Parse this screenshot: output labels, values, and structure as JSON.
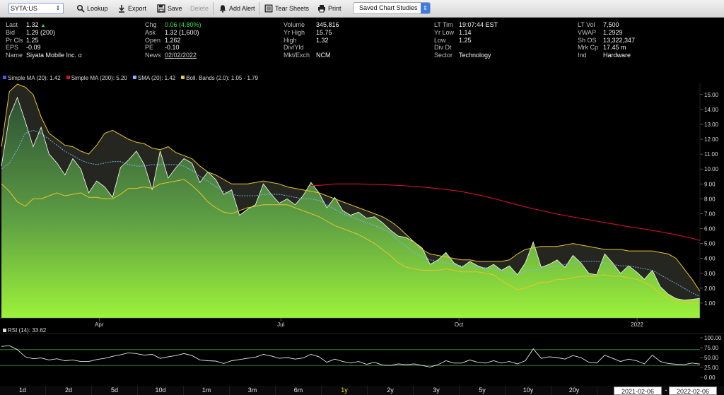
{
  "toolbar": {
    "ticker_value": "SYTA:US",
    "buttons": [
      {
        "label": "Lookup",
        "icon": "magnifier-icon"
      },
      {
        "label": "Export",
        "icon": "download-icon"
      },
      {
        "label": "Save",
        "icon": "floppy-icon"
      },
      {
        "label": "Delete",
        "icon": "none"
      },
      {
        "label": "Add Alert",
        "icon": "bell-icon"
      },
      {
        "label": "Tear Sheets",
        "icon": "sheet-icon"
      },
      {
        "label": "Print",
        "icon": "printer-icon"
      }
    ],
    "studies_label": "Saved Chart Studies"
  },
  "quote": {
    "col1": [
      {
        "label": "Last",
        "value": "1.32"
      },
      {
        "label": "Bid",
        "value": "1.29 (200)"
      },
      {
        "label": "Pr Cls",
        "value": "1.25"
      },
      {
        "label": "EPS",
        "value": "-0.09"
      },
      {
        "label": "Name",
        "value": "Siyata Mobile Inc."
      }
    ],
    "col2": [
      {
        "label": "Chg",
        "value": "0.06 (4.80%)"
      },
      {
        "label": "Ask",
        "value": "1.32 (1,600)"
      },
      {
        "label": "Open",
        "value": "1.262"
      },
      {
        "label": "PE",
        "value": "-0.10"
      },
      {
        "label": "News",
        "value": "02/02/2022"
      }
    ],
    "col3": [
      {
        "label": "Volume",
        "value": "345,816"
      },
      {
        "label": "Yr High",
        "value": "15.75"
      },
      {
        "label": "High",
        "value": "1.32"
      },
      {
        "label": "Div/Yld",
        "value": ""
      },
      {
        "label": "Mkt/Exch",
        "value": "NCM"
      }
    ],
    "col4": [
      {
        "label": "LT Tim",
        "value": "19:07:44 EST"
      },
      {
        "label": "Yr Low",
        "value": "1.14"
      },
      {
        "label": "Low",
        "value": "1.25"
      },
      {
        "label": "Div Dt",
        "value": ""
      },
      {
        "label": "Sector",
        "value": "Technology"
      }
    ],
    "col5": [
      {
        "label": "LT Vol",
        "value": "7,500"
      },
      {
        "label": "VWAP",
        "value": "1.2929"
      },
      {
        "label": "Sh OS",
        "value": "13,322,347"
      },
      {
        "label": "Mrk Cp",
        "value": "17.45 m"
      },
      {
        "label": "Ind",
        "value": "Hardware"
      }
    ],
    "name_suffix": "α",
    "colors": {
      "up": "#35e24a"
    }
  },
  "legend": [
    {
      "label": "Simple MA (20): 1.42",
      "color": "#3a5cff"
    },
    {
      "label": "Simple MA (200): 5.20",
      "color": "#d0122c"
    },
    {
      "label": "SMA (20): 1.42",
      "color": "#7fb6ff"
    },
    {
      "label": "Boll. Bands (2.0): 1.05 - 1.79",
      "color": "#e6c62c"
    }
  ],
  "chart_data": [
    {
      "type": "area",
      "yticks": [
        "1.00",
        "2.00",
        "3.00",
        "4.00",
        "5.00",
        "6.00",
        "7.00",
        "8.00",
        "9.00",
        "10.00",
        "11.00",
        "12.00",
        "13.00",
        "14.00",
        "15.00"
      ],
      "ylim": [
        0,
        15.75
      ],
      "xticks": [
        "Apr",
        "Jul",
        "Oct",
        "2022"
      ],
      "xtick_pos": [
        0.14,
        0.4,
        0.655,
        0.91
      ],
      "price": [
        10.2,
        13.5,
        14.8,
        13.2,
        11.5,
        12.8,
        11.0,
        10.4,
        9.6,
        10.7,
        10.0,
        8.4,
        9.2,
        8.8,
        8.1,
        10.1,
        10.6,
        11.2,
        10.3,
        8.6,
        11.2,
        9.4,
        10.1,
        10.7,
        10.4,
        9.1,
        9.8,
        9.3,
        8.3,
        8.6,
        6.9,
        7.3,
        7.6,
        9.0,
        8.3,
        7.7,
        8.0,
        7.6,
        8.2,
        9.1,
        8.4,
        7.4,
        8.1,
        7.2,
        6.9,
        7.1,
        6.7,
        6.8,
        6.4,
        5.9,
        5.5,
        5.4,
        5.1,
        4.7,
        3.6,
        3.9,
        4.4,
        3.7,
        3.4,
        3.8,
        3.5,
        3.3,
        3.6,
        3.2,
        3.5,
        2.9,
        3.7,
        5.1,
        3.4,
        3.6,
        3.9,
        3.4,
        4.2,
        3.7,
        3.0,
        2.9,
        4.3,
        3.7,
        3.0,
        3.5,
        3.1,
        2.6,
        3.2,
        2.1,
        1.6,
        1.3,
        1.2,
        1.25,
        1.32
      ],
      "bb_upper": [
        11.5,
        15.2,
        15.7,
        15.5,
        15.0,
        13.5,
        12.4,
        12.0,
        11.6,
        11.5,
        11.2,
        11.0,
        11.6,
        12.4,
        12.6,
        12.3,
        12.0,
        11.8,
        11.7,
        11.4,
        11.3,
        11.5,
        11.1,
        10.9,
        10.7,
        10.2,
        9.8,
        9.6,
        9.3,
        9.0,
        9.0,
        9.0,
        9.1,
        9.2,
        9.1,
        9.0,
        8.8,
        8.7,
        8.6,
        8.5,
        8.4,
        8.2,
        8.0,
        7.8,
        7.6,
        7.4,
        7.2,
        7.0,
        6.8,
        6.5,
        6.1,
        5.6,
        5.1,
        4.6,
        4.3,
        4.2,
        4.1,
        4.0,
        3.9,
        3.9,
        3.8,
        3.8,
        3.8,
        3.8,
        3.9,
        4.3,
        4.6,
        4.7,
        4.8,
        4.8,
        4.8,
        4.9,
        5.0,
        4.9,
        4.8,
        4.7,
        4.6,
        4.6,
        4.6,
        4.5,
        4.5,
        4.5,
        4.5,
        4.4,
        4.3,
        4.0,
        3.3,
        2.6,
        1.8
      ],
      "bb_lower": [
        9.0,
        8.5,
        7.8,
        7.5,
        8.0,
        8.0,
        8.2,
        8.4,
        8.2,
        8.3,
        8.4,
        8.1,
        8.1,
        8.0,
        8.0,
        8.3,
        8.7,
        8.7,
        8.8,
        8.7,
        9.0,
        9.1,
        9.2,
        9.3,
        8.9,
        8.4,
        7.8,
        7.4,
        7.1,
        7.0,
        7.2,
        7.4,
        7.5,
        7.6,
        7.6,
        7.6,
        7.6,
        7.4,
        7.2,
        7.0,
        6.8,
        6.5,
        6.2,
        6.0,
        5.8,
        5.6,
        5.3,
        5.0,
        4.6,
        4.2,
        3.7,
        3.4,
        3.3,
        3.2,
        3.2,
        3.2,
        3.3,
        3.2,
        3.1,
        3.1,
        3.1,
        3.0,
        2.9,
        2.5,
        2.2,
        1.9,
        2.0,
        2.2,
        2.4,
        2.4,
        2.6,
        2.6,
        2.7,
        2.8,
        2.8,
        2.8,
        2.9,
        2.8,
        2.8,
        2.7,
        2.6,
        2.4,
        2.1,
        1.6,
        1.3,
        1.1,
        1.0,
        1.0,
        1.05
      ],
      "sma20": [
        10.0,
        10.4,
        11.3,
        12.4,
        12.6,
        12.4,
        12.0,
        11.6,
        11.2,
        10.9,
        10.6,
        10.4,
        10.3,
        10.4,
        10.5,
        10.5,
        10.3,
        10.2,
        10.2,
        10.3,
        10.3,
        10.3,
        10.3,
        10.2,
        9.9,
        9.5,
        9.2,
        8.8,
        8.5,
        8.3,
        8.2,
        8.2,
        8.2,
        8.3,
        8.3,
        8.3,
        8.2,
        8.1,
        8.0,
        8.0,
        7.9,
        7.6,
        7.3,
        7.0,
        6.8,
        6.6,
        6.4,
        6.2,
        6.0,
        5.7,
        5.2,
        4.8,
        4.4,
        4.1,
        3.9,
        3.8,
        3.7,
        3.6,
        3.5,
        3.5,
        3.4,
        3.4,
        3.3,
        3.2,
        3.0,
        3.0,
        3.1,
        3.2,
        3.3,
        3.4,
        3.5,
        3.6,
        3.7,
        3.8,
        3.8,
        3.8,
        3.7,
        3.6,
        3.5,
        3.5,
        3.4,
        3.3,
        3.2,
        2.9,
        2.6,
        2.3,
        2.0,
        1.7,
        1.42
      ],
      "sma200": [
        null,
        null,
        null,
        null,
        null,
        null,
        null,
        null,
        null,
        null,
        null,
        null,
        null,
        null,
        null,
        null,
        null,
        null,
        null,
        null,
        null,
        null,
        null,
        null,
        null,
        null,
        null,
        null,
        null,
        null,
        null,
        null,
        null,
        null,
        null,
        null,
        null,
        null,
        null,
        8.9,
        8.9,
        8.95,
        9.0,
        9.0,
        9.0,
        9.0,
        8.98,
        8.97,
        8.95,
        8.93,
        8.9,
        8.87,
        8.83,
        8.79,
        8.74,
        8.69,
        8.63,
        8.56,
        8.48,
        8.38,
        8.27,
        8.15,
        8.02,
        7.88,
        7.74,
        7.6,
        7.46,
        7.33,
        7.21,
        7.09,
        6.98,
        6.88,
        6.78,
        6.69,
        6.6,
        6.5,
        6.41,
        6.32,
        6.23,
        6.13,
        6.05,
        5.97,
        5.88,
        5.79,
        5.69,
        5.59,
        5.47,
        5.35,
        5.2
      ]
    },
    {
      "type": "line",
      "title": "RSI (14): 33.62",
      "yticks": [
        "0.00",
        "25.00",
        "50.00",
        "75.00",
        "100.00"
      ],
      "ylim": [
        0,
        100
      ],
      "rsi": [
        78,
        80,
        70,
        52,
        47,
        49,
        44,
        47,
        42,
        44,
        40,
        40,
        45,
        48,
        53,
        57,
        62,
        60,
        56,
        58,
        48,
        52,
        55,
        60,
        55,
        44,
        42,
        41,
        35,
        42,
        45,
        48,
        51,
        58,
        54,
        48,
        50,
        46,
        49,
        58,
        52,
        38,
        46,
        40,
        36,
        40,
        33,
        38,
        31,
        30,
        34,
        32,
        34,
        30,
        26,
        32,
        42,
        36,
        36,
        44,
        38,
        36,
        42,
        36,
        40,
        34,
        42,
        72,
        48,
        52,
        50,
        46,
        55,
        50,
        38,
        36,
        56,
        48,
        40,
        46,
        42,
        34,
        56,
        40,
        35,
        33,
        32,
        36,
        33.6
      ]
    }
  ],
  "periods": [
    "1d",
    "2d",
    "5d",
    "10d",
    "1m",
    "3m",
    "6m",
    "1y",
    "2y",
    "3y",
    "5y",
    "10y",
    "20y"
  ],
  "active_period": "1y",
  "date_range": {
    "from": "2021-02-06",
    "sep": "-",
    "to": "2022-02-06"
  }
}
